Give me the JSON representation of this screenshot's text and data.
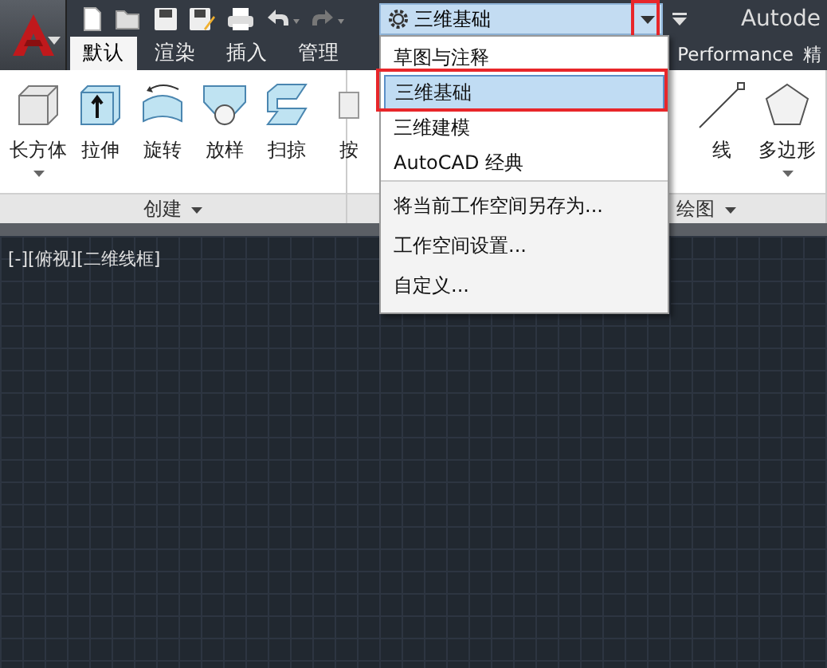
{
  "title": "Autode",
  "workspace": {
    "value": "三维基础"
  },
  "ribbon_tabs": [
    {
      "label": "默认",
      "selected": true
    },
    {
      "label": "渲染",
      "selected": false
    },
    {
      "label": "插入",
      "selected": false
    },
    {
      "label": "管理",
      "selected": false
    }
  ],
  "ribbon_tabs_right": [
    {
      "label": "Performance",
      "selected": false
    },
    {
      "label": "精",
      "selected": false
    }
  ],
  "panels": [
    {
      "label": "创建",
      "tools": [
        {
          "label": "长方体",
          "dropdown": true
        },
        {
          "label": "拉伸",
          "dropdown": false
        },
        {
          "label": "旋转",
          "dropdown": false
        },
        {
          "label": "放样",
          "dropdown": false
        },
        {
          "label": "扫掠",
          "dropdown": false
        },
        {
          "label": "按",
          "dropdown": false
        }
      ]
    },
    {
      "label": "绘图",
      "tools": [
        {
          "label": "线",
          "dropdown": false
        },
        {
          "label": "多边形",
          "dropdown": true
        }
      ]
    }
  ],
  "viewport_label": "[-][俯视][二维线框]",
  "workspace_menu": {
    "items": [
      {
        "label": "草图与注释",
        "selected": false
      },
      {
        "label": "三维基础",
        "selected": true
      },
      {
        "label": "三维建模",
        "selected": false
      },
      {
        "label": "AutoCAD 经典",
        "selected": false
      }
    ],
    "actions": [
      "将当前工作空间另存为...",
      "工作空间设置...",
      "自定义..."
    ]
  }
}
